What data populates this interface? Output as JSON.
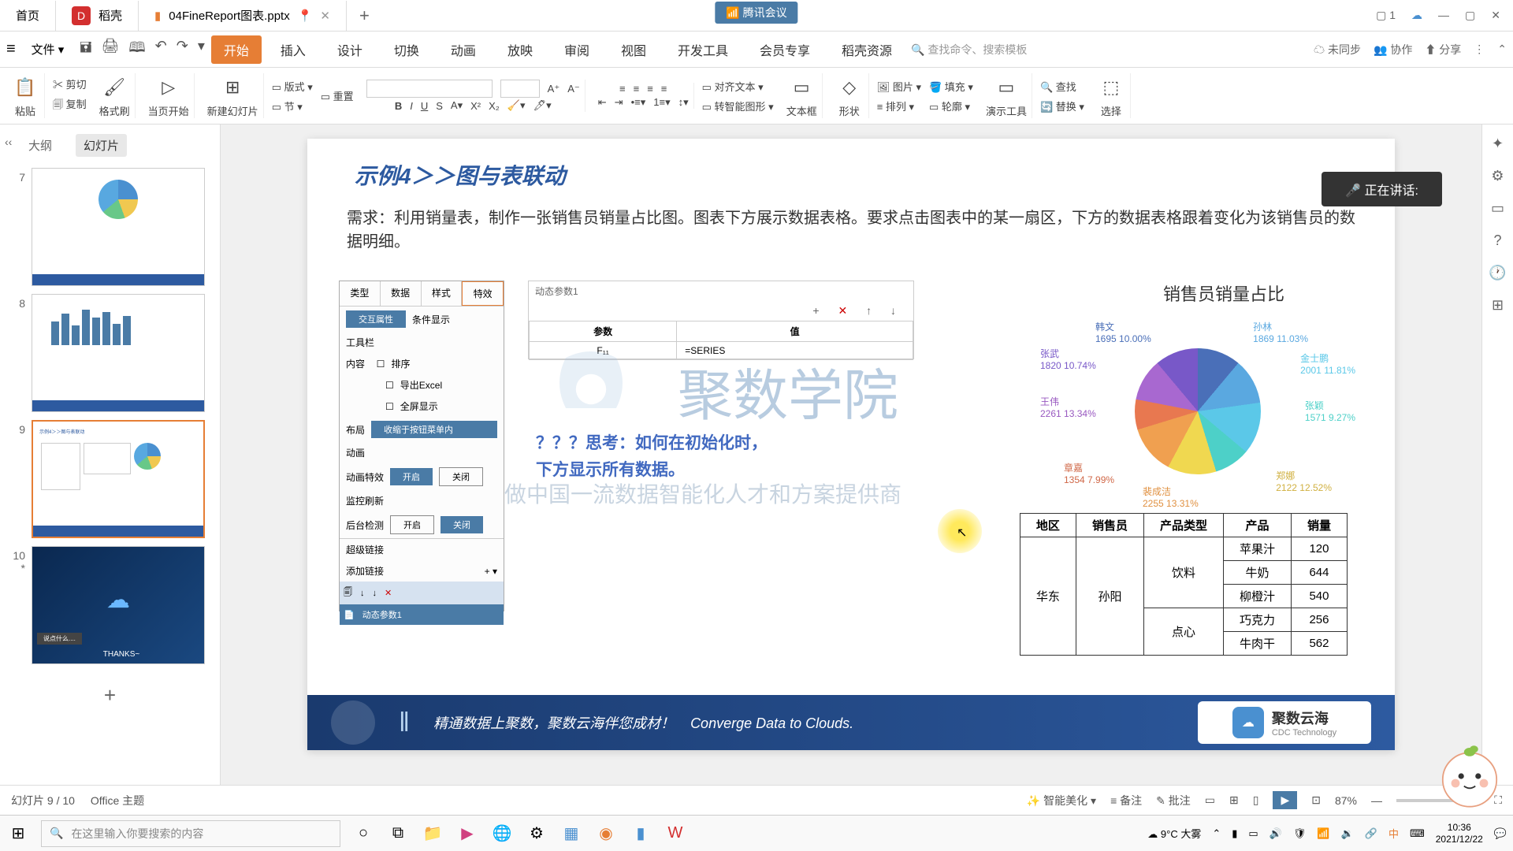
{
  "titlebar": {
    "tab_home": "首页",
    "tab_docer": "稻壳",
    "tab_file": "04FineReport图表.pptx",
    "new_tab": "+",
    "tencent": "腾讯会议"
  },
  "menubar": {
    "file": "文件",
    "tabs": [
      "开始",
      "插入",
      "设计",
      "切换",
      "动画",
      "放映",
      "审阅",
      "视图",
      "开发工具",
      "会员专享",
      "稻壳资源"
    ],
    "search_ph": "查找命令、搜索模板",
    "unsync": "未同步",
    "coop": "协作",
    "share": "分享"
  },
  "ribbon": {
    "paste": "粘贴",
    "cut": "剪切",
    "copy": "复制",
    "brush": "格式刷",
    "page_start": "当页开始",
    "new_slide": "新建幻灯片",
    "layout": "版式",
    "reset": "重置",
    "section": "节",
    "align_text": "对齐文本",
    "smart_graphic": "转智能图形",
    "textbox": "文本框",
    "shape": "形状",
    "arrange": "排列",
    "image": "图片",
    "fill": "填充",
    "outline": "轮廓",
    "tools": "演示工具",
    "find": "查找",
    "replace": "替换",
    "select": "选择"
  },
  "sidepanel": {
    "outline": "大纲",
    "slides": "幻灯片",
    "nums": [
      "7",
      "8",
      "9",
      "10"
    ],
    "star": "*",
    "comment_ph": "说点什么....",
    "thanks": "THANKS~"
  },
  "slide": {
    "title": "示例4＞＞图与表联动",
    "req": "需求：利用销量表，制作一张销售员销量占比图。图表下方展示数据表格。要求点击图表中的某一扇区，下方的数据表格跟着变化为该销售员的数据明细。",
    "think1": "？？？思考：如何在初始化时，",
    "think2": "下方显示所有数据。",
    "wm_text": "聚数学院",
    "wm_sub": "做中国一流数据智能化人才和方案提供商",
    "footer_cn": "精通数据上聚数，聚数云海伴您成材！",
    "footer_en": "Converge Data to Clouds.",
    "brand": "聚数云海",
    "brand_sub": "CDC Technology"
  },
  "cfg": {
    "tabs": [
      "类型",
      "数据",
      "样式",
      "特效"
    ],
    "inter": "交互属性",
    "cond": "条件显示",
    "toolbar": "工具栏",
    "content": "内容",
    "sort": "排序",
    "export": "导出Excel",
    "fullscreen": "全屏显示",
    "layout": "布局",
    "layout_val": "收缩于按钮菜单内",
    "anim": "动画",
    "anim_fx": "动画特效",
    "on": "开启",
    "off": "关闭",
    "monitor": "监控刷新",
    "backend": "后台检测",
    "link": "超级链接",
    "add_link": "添加链接",
    "param1": "动态参数1"
  },
  "param_panel": {
    "title": "动态参数1",
    "col_param": "参数",
    "col_val": "值",
    "p1": "F₁₁",
    "v1": "=SERIES"
  },
  "chart_data": {
    "type": "pie",
    "title": "销售员销量占比",
    "series": [
      {
        "name": "韩文",
        "value": 1695,
        "pct": "10.00%",
        "color": "#4a6fb8"
      },
      {
        "name": "孙林",
        "value": 1869,
        "pct": "11.03%",
        "color": "#5aa8e0"
      },
      {
        "name": "金士鹏",
        "value": 2001,
        "pct": "11.81%",
        "color": "#5bc8e8"
      },
      {
        "name": "张颖",
        "value": 1571,
        "pct": "9.27%",
        "color": "#4dd0c8"
      },
      {
        "name": "郑娜",
        "value": 2122,
        "pct": "12.52%",
        "color": "#f0d850"
      },
      {
        "name": "裴成洁",
        "value": 2255,
        "pct": "13.31%",
        "color": "#f0a050"
      },
      {
        "name": "章嘉",
        "value": 1354,
        "pct": "7.99%",
        "color": "#e87850"
      },
      {
        "name": "王伟",
        "value": 2261,
        "pct": "13.34%",
        "color": "#a868d0"
      },
      {
        "name": "张武",
        "value": 1820,
        "pct": "10.74%",
        "color": "#7858c8"
      }
    ]
  },
  "table": {
    "hdr": [
      "地区",
      "销售员",
      "产品类型",
      "产品",
      "销量"
    ],
    "region": "华东",
    "sales": "孙阳",
    "type1": "饮料",
    "type2": "点心",
    "rows": [
      {
        "prod": "苹果汁",
        "qty": "120"
      },
      {
        "prod": "牛奶",
        "qty": "644"
      },
      {
        "prod": "柳橙汁",
        "qty": "540"
      },
      {
        "prod": "巧克力",
        "qty": "256"
      },
      {
        "prod": "牛肉干",
        "qty": "562"
      }
    ]
  },
  "status": {
    "slide_count": "幻灯片 9 / 10",
    "theme": "Office 主题",
    "smart": "智能美化",
    "notes": "备注",
    "comments": "批注",
    "zoom": "87%"
  },
  "taskbar": {
    "search_ph": "在这里输入你要搜索的内容",
    "weather": "9°C 大雾",
    "time": "10:36",
    "date": "2021/12/22"
  },
  "speaking": "正在讲话:"
}
